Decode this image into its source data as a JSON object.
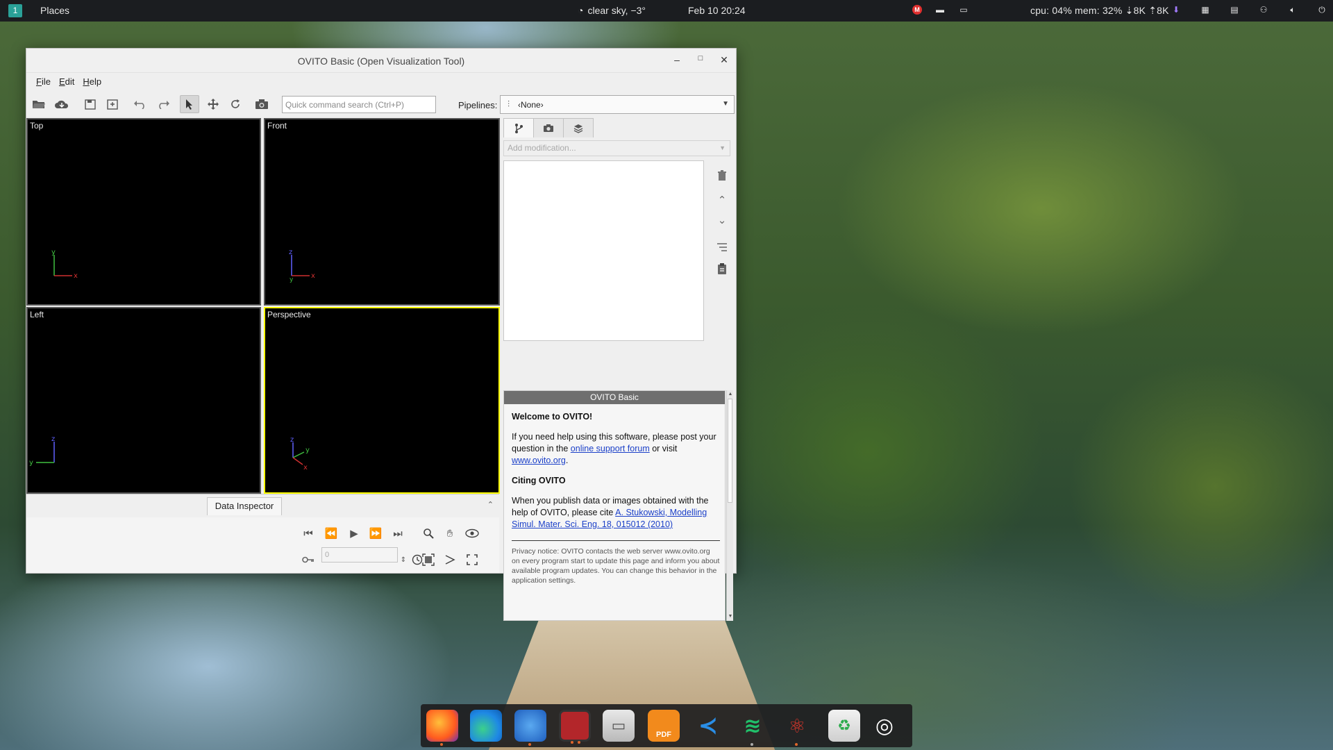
{
  "top_panel": {
    "workspace": "1",
    "places": "Places",
    "weather": "clear sky, −3°",
    "clock": "Feb 10  20:24",
    "sysinfo": "cpu: 04% mem: 32% ⇣8K ⇡8K"
  },
  "window": {
    "title": "OVITO Basic (Open Visualization Tool)",
    "minimize": "–",
    "maximize": "□",
    "close": "✕"
  },
  "menu": [
    "File",
    "Edit",
    "Help"
  ],
  "toolbar": {
    "search_placeholder": "Quick command search (Ctrl+P)",
    "pipelines_label": "Pipelines:",
    "pipelines_value": "‹None›"
  },
  "viewports": {
    "top": "Top",
    "front": "Front",
    "left": "Left",
    "perspective": "Perspective"
  },
  "axis_labels": {
    "x": "x",
    "y": "y",
    "z": "z"
  },
  "bottom": {
    "data_inspector": "Data Inspector",
    "frame_value": "0"
  },
  "right_panel": {
    "add_modification": "Add modification..."
  },
  "info": {
    "header": "OVITO Basic",
    "welcome": "Welcome to OVITO!",
    "help_text_1": "If you need help using this software, please post your question in the ",
    "help_link_forum": "online support forum",
    "help_text_2": " or visit ",
    "help_link_site": "www.ovito.org",
    "help_text_3": ".",
    "citing_title": "Citing OVITO",
    "citing_text": "When you publish data or images obtained with the help of OVITO, please cite ",
    "citing_link": "A. Stukowski, Modelling Simul. Mater. Sci. Eng. 18, 015012 (2010)",
    "privacy": "Privacy notice: OVITO contacts the web server www.ovito.org on every program start to update this page and inform you about available program updates. You can change this behavior in the application settings."
  },
  "colors": {
    "active_viewport_border": "#ffff00",
    "axis_x": "#d03030",
    "axis_y": "#40c040",
    "axis_z": "#6060ff"
  },
  "dock": {
    "pdf_label": "PDF"
  }
}
